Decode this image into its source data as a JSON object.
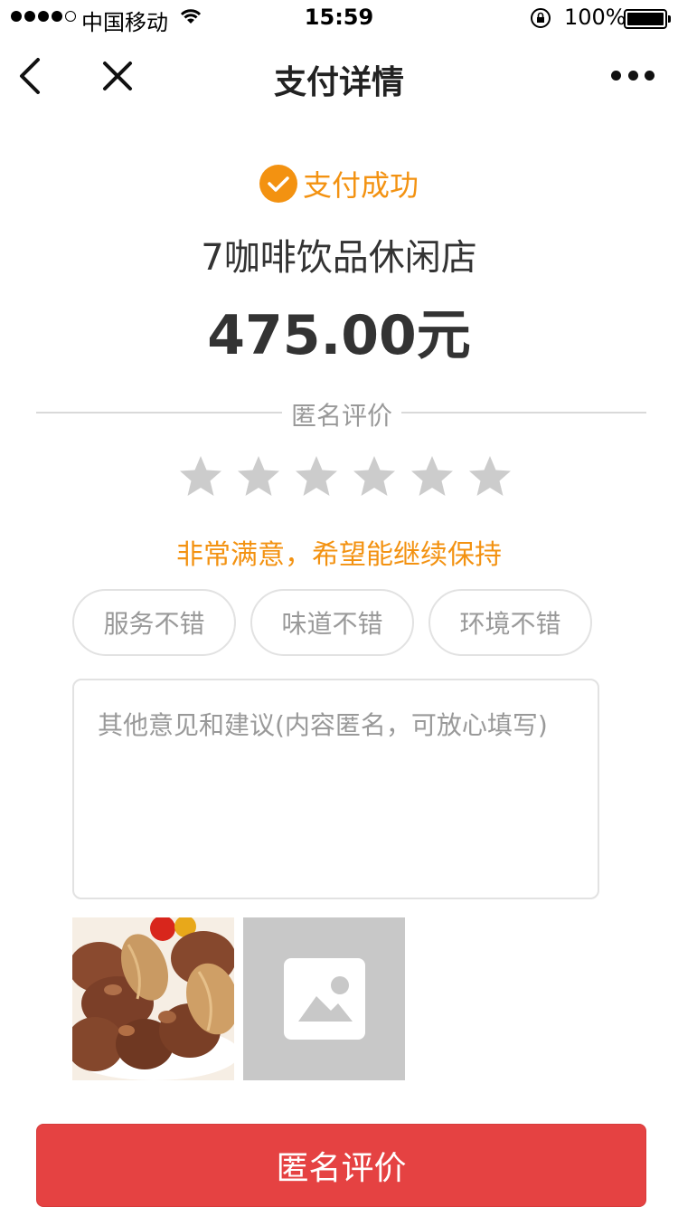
{
  "status_bar": {
    "carrier": "中国移动",
    "time": "15:59",
    "battery": "100%",
    "icons": [
      "signal-dots-icon",
      "wifi-icon",
      "rotation-lock-icon",
      "battery-icon"
    ]
  },
  "nav": {
    "title": "支付详情",
    "icons": [
      "back-chevron-icon",
      "close-icon",
      "more-dots-icon"
    ]
  },
  "payment": {
    "status_text": "支付成功",
    "status_color": "#f39211",
    "store_name": "7咖啡饮品休闲店",
    "amount": "475.00元"
  },
  "review": {
    "section_label": "匿名评价",
    "star_count": 6,
    "rating_selected": 0,
    "star_color": "#cccccc",
    "rating_text": "非常满意，希望能继续保持",
    "tags": [
      "服务不错",
      "味道不错",
      "环境不错"
    ],
    "comment_placeholder": "其他意见和建议(内容匿名，可放心填写)",
    "photos": [
      "food-photo",
      "add-photo-placeholder-icon"
    ],
    "submit_label": "匿名评价",
    "submit_color": "#e54242"
  }
}
